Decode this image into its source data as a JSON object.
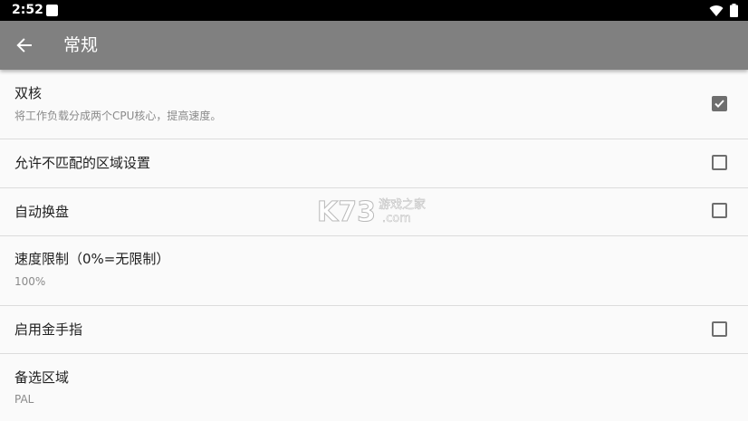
{
  "status_bar": {
    "time": "2:52",
    "icons": [
      "notification-icon",
      "wifi-icon",
      "battery-icon"
    ]
  },
  "toolbar": {
    "back_icon": "arrow-back-icon",
    "title": "常规",
    "background": "#808080"
  },
  "settings": [
    {
      "title": "双核",
      "subtitle": "将工作负载分成两个CPU核心，提高速度。",
      "checkbox": true,
      "checked": true
    },
    {
      "title": "允许不匹配的区域设置",
      "subtitle": "",
      "checkbox": true,
      "checked": false
    },
    {
      "title": "自动换盘",
      "subtitle": "",
      "checkbox": true,
      "checked": false
    },
    {
      "title": "速度限制（0%=无限制）",
      "subtitle": "100%",
      "checkbox": false
    },
    {
      "title": "启用金手指",
      "subtitle": "",
      "checkbox": true,
      "checked": false
    },
    {
      "title": "备选区域",
      "subtitle": "PAL",
      "checkbox": false
    }
  ],
  "watermark": {
    "logo_text": "K73",
    "tagline": "游戏之家",
    "domain": ".com"
  }
}
